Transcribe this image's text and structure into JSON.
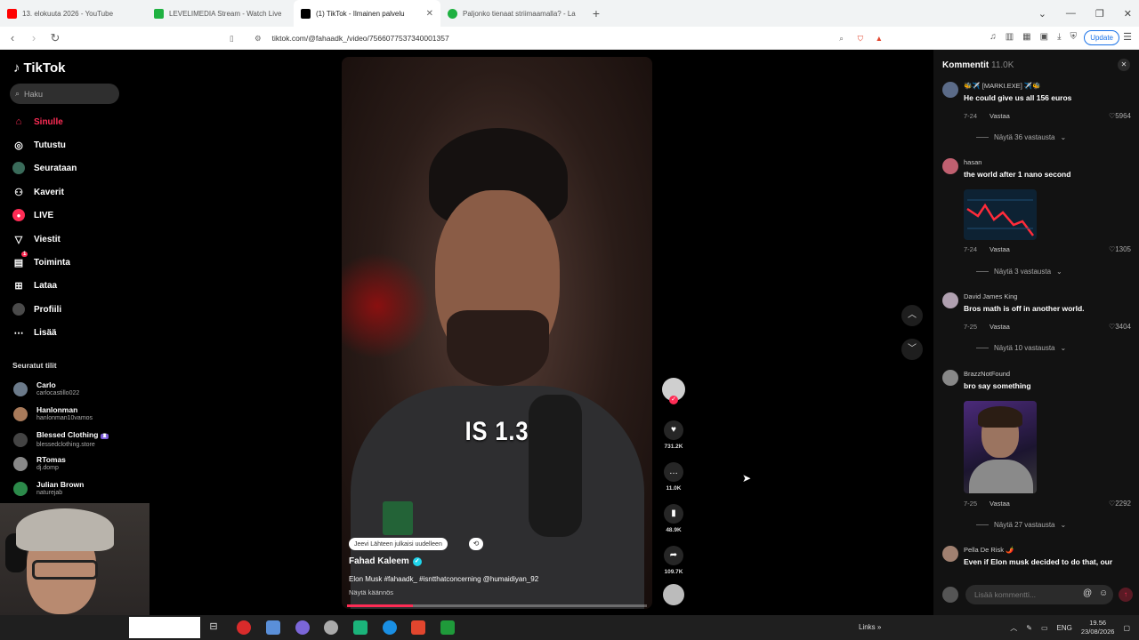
{
  "browser": {
    "tabs": [
      {
        "title": "13. elokuuta 2026 - YouTube",
        "color": "#ff0000"
      },
      {
        "title": "LEVELIMEDIA Stream - Watch Live",
        "color": "#1fb141"
      },
      {
        "title": "(1) TikTok - Ilmainen palvelu",
        "color": "#000000"
      },
      {
        "title": "Paljonko tienaat striimaamalla? - La",
        "color": "#1fb141"
      }
    ],
    "url": "tiktok.com/@fahaadk_/video/7566077537340001357",
    "update_label": "Update"
  },
  "sidebar": {
    "brand": "TikTok",
    "search_placeholder": "Haku",
    "nav": [
      {
        "label": "Sinulle",
        "icon": "home-icon"
      },
      {
        "label": "Tutustu",
        "icon": "compass-icon"
      },
      {
        "label": "Seurataan",
        "icon": "following-icon"
      },
      {
        "label": "Kaverit",
        "icon": "friends-icon"
      },
      {
        "label": "LIVE",
        "icon": "live-icon"
      },
      {
        "label": "Viestit",
        "icon": "messages-icon"
      },
      {
        "label": "Toiminta",
        "icon": "activity-icon"
      },
      {
        "label": "Lataa",
        "icon": "upload-icon"
      },
      {
        "label": "Profiili",
        "icon": "profile-icon"
      },
      {
        "label": "Lisää",
        "icon": "more-icon"
      }
    ],
    "activity_badge": "1",
    "following_title": "Seuratut tilit",
    "following": [
      {
        "name": "Carlo",
        "handle": "carlocastillo022",
        "color": "#6b7a8a"
      },
      {
        "name": "Hanlonman",
        "handle": "hanlonman10vamos",
        "color": "#a87a5a"
      },
      {
        "name": "Blessed Clothing",
        "handle": "blessedclothing.store",
        "color": "#444444"
      },
      {
        "name": "RTomas",
        "handle": "dj.domp",
        "color": "#888888"
      },
      {
        "name": "Julian Brown",
        "handle": "naturejab",
        "color": "#2c8a4a"
      }
    ]
  },
  "video": {
    "caption": "IS 1.3",
    "chip": "Jeevi Lähteen julkaisi uudelleen",
    "author": "Fahad Kaleem",
    "description": "Elon Musk #fahaadk_ #isntthatconcerning @humaidiyan_92",
    "see_translation": "Näytä käännös",
    "progress": 0.22
  },
  "actions": {
    "likes": "731.2K",
    "comments": "11.0K",
    "saves": "48.9K",
    "shares": "109.7K"
  },
  "comments_panel": {
    "title": "Kommentit",
    "count": "11.0K",
    "reply_label": "Vastaa",
    "comments": [
      {
        "user": "🐝✈️ [MARKI.EXE] ✈️🐝",
        "text": "He could give us all 156 euros",
        "date": "7-24",
        "likes": "5964",
        "replies": "Näytä 36 vastausta",
        "color": "#5b6b88"
      },
      {
        "user": "hasan",
        "text": "the world after 1 nano second",
        "date": "7-24",
        "likes": "1305",
        "replies": "Näytä 3 vastausta",
        "color": "#c06070"
      },
      {
        "user": "David James King",
        "text": "Bros math is off in another world.",
        "date": "7-25",
        "likes": "3404",
        "replies": "Näytä 10 vastausta",
        "color": "#b0a0b0"
      },
      {
        "user": "BrazzNotFound",
        "text": "bro say something",
        "date": "7-25",
        "likes": "2292",
        "replies": "Näytä 27 vastausta",
        "color": "#888888"
      },
      {
        "user": "Pella De Risk 🌶️",
        "text": "Even if Elon musk decided to do that, our",
        "color": "#a08070"
      }
    ],
    "input_placeholder": "Lisää kommentti..."
  },
  "taskbar": {
    "links_label": "Links",
    "lang": "ENG",
    "time": "19.56",
    "date": "23/08/2026"
  }
}
